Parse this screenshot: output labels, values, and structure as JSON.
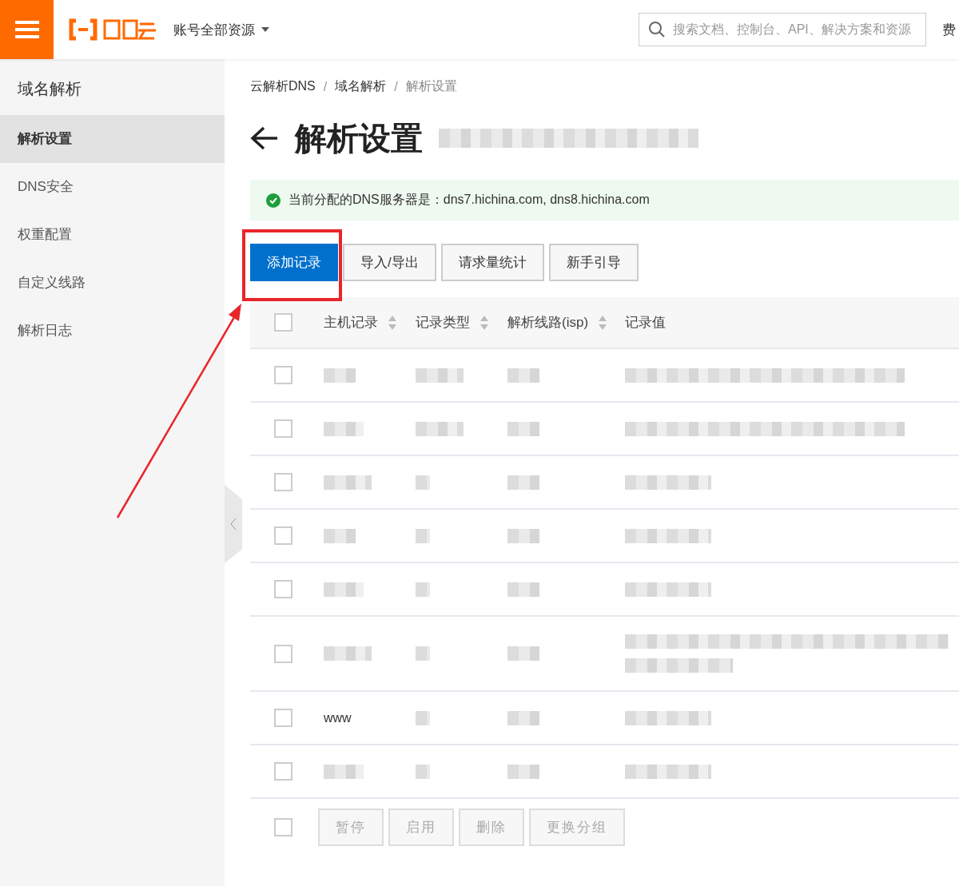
{
  "topbar": {
    "account_menu": "账号全部资源",
    "search": {
      "placeholder": "搜索文档、控制台、API、解决方案和资源"
    },
    "cut_link": "费"
  },
  "sidebar": {
    "title": "域名解析",
    "items": [
      {
        "label": "解析设置",
        "selected": true
      },
      {
        "label": "DNS安全",
        "selected": false
      },
      {
        "label": "权重配置",
        "selected": false
      },
      {
        "label": "自定义线路",
        "selected": false
      },
      {
        "label": "解析日志",
        "selected": false
      }
    ]
  },
  "breadcrumb": [
    "云解析DNS",
    "域名解析",
    "解析设置"
  ],
  "breadcrumb_separator": "/",
  "page_title": "解析设置",
  "notice": "当前分配的DNS服务器是：dns7.hichina.com, dns8.hichina.com",
  "actions": [
    {
      "label": "添加记录",
      "primary": true
    },
    {
      "label": "导入/导出",
      "primary": false
    },
    {
      "label": "请求量统计",
      "primary": false
    },
    {
      "label": "新手引导",
      "primary": false
    }
  ],
  "table": {
    "select_all_checked": false,
    "footer_select_checked": false,
    "columns": [
      {
        "label": "主机记录",
        "sortable": true
      },
      {
        "label": "记录类型",
        "sortable": true
      },
      {
        "label": "解析线路(isp)",
        "sortable": true
      },
      {
        "label": "记录值",
        "sortable": false
      }
    ],
    "rows": [
      {
        "kind": "single",
        "checked": false
      },
      {
        "kind": "single",
        "checked": false
      },
      {
        "kind": "single",
        "checked": false
      },
      {
        "kind": "single",
        "checked": false
      },
      {
        "kind": "single",
        "checked": false
      },
      {
        "kind": "double",
        "checked": false
      },
      {
        "kind": "single",
        "checked": false,
        "host": "www"
      },
      {
        "kind": "single",
        "checked": false
      }
    ]
  },
  "bulk_actions": [
    {
      "label": "暂停",
      "disabled": true
    },
    {
      "label": "启用",
      "disabled": true
    },
    {
      "label": "删除",
      "disabled": true
    },
    {
      "label": "更换分组",
      "disabled": true
    }
  ]
}
